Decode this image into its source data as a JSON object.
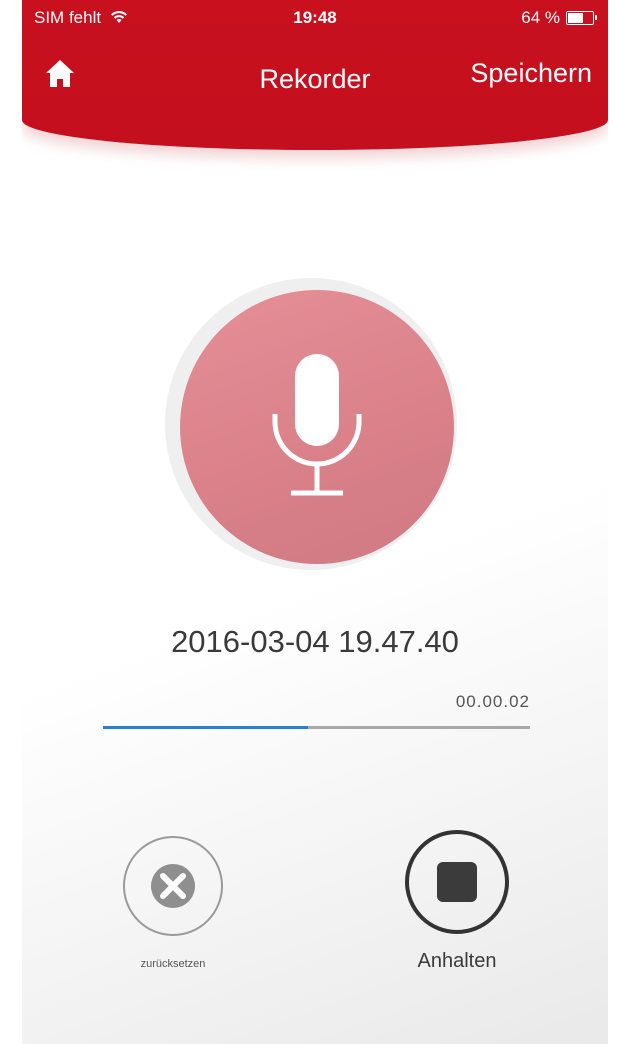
{
  "status_bar": {
    "carrier": "SIM fehlt",
    "time": "19:48",
    "battery_text": "64 %",
    "battery_level": 0.64
  },
  "nav": {
    "home_icon": "home-icon",
    "title": "Rekorder",
    "save_label": "Speichern"
  },
  "recorder": {
    "mic_icon": "microphone-icon",
    "timestamp": "2016-03-04 19.47.40",
    "elapsed": "00.00.02",
    "progress": 0.48
  },
  "controls": {
    "reset_icon": "close-icon",
    "reset_label": "zurücksetzen",
    "stop_icon": "stop-icon",
    "stop_label": "Anhalten"
  },
  "colors": {
    "header": "#c8101f",
    "mic_button": "#db838c",
    "progress": "#2a7fd4"
  }
}
